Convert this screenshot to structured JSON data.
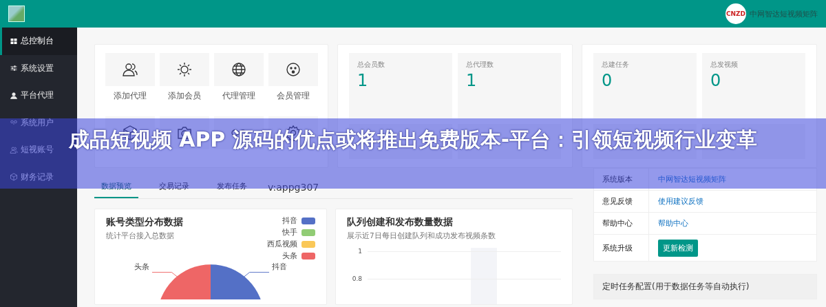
{
  "topbar": {
    "brand_badge": "CNZD",
    "brand_name": "中网智达短视频矩阵"
  },
  "sidebar": {
    "items": [
      {
        "label": "总控制台",
        "selected": true
      },
      {
        "label": "系统设置",
        "selected": false
      },
      {
        "label": "平台代理",
        "selected": false
      },
      {
        "label": "系统用户",
        "selected": false
      },
      {
        "label": "短视账号",
        "selected": false
      },
      {
        "label": "财务记录",
        "selected": false
      }
    ]
  },
  "shortcuts": [
    {
      "label": "添加代理"
    },
    {
      "label": "添加会员"
    },
    {
      "label": "代理管理"
    },
    {
      "label": "会员管理"
    }
  ],
  "stat_groups": [
    [
      {
        "label": "总会员数",
        "value": "1"
      },
      {
        "label": "总代理数",
        "value": "1"
      }
    ],
    [
      {
        "label": "总建任务",
        "value": "0"
      },
      {
        "label": "总发视频",
        "value": "0"
      }
    ]
  ],
  "tabs": [
    {
      "label": "数据预览",
      "selected": true
    },
    {
      "label": "交易记录",
      "selected": false
    },
    {
      "label": "发布任务",
      "selected": false
    }
  ],
  "tabs_note": "v:appg307",
  "pie_card": {
    "title": "账号类型分布数据",
    "subtitle": "统计平台接入总数据",
    "legend": [
      {
        "label": "抖音",
        "color": "#5470c6"
      },
      {
        "label": "快手",
        "color": "#91cc75"
      },
      {
        "label": "西瓜视频",
        "color": "#fac858"
      },
      {
        "label": "头条",
        "color": "#ee6666"
      }
    ],
    "slice_labels": [
      "头条",
      "抖音"
    ]
  },
  "bar_card": {
    "title": "队列创建和发布数量数据",
    "subtitle": "展示近7日每日创建队列和成功发布视频条数",
    "axis_labels": [
      "1",
      "0.8"
    ]
  },
  "info_table": [
    {
      "key": "系统版本",
      "value": "中网智达短视频矩阵",
      "kind": "link"
    },
    {
      "key": "意见反馈",
      "value": "使用建议反馈",
      "kind": "link"
    },
    {
      "key": "帮助中心",
      "value": "帮助中心",
      "kind": "link"
    },
    {
      "key": "系统升级",
      "value": "更新检测",
      "kind": "button"
    }
  ],
  "cron_panel": {
    "title": "定时任务配置(用于数据任务等自动执行)"
  },
  "banner": {
    "title": "成品短视频 APP 源码的优点或将推出免费版本-平台：引领短视频行业变革"
  }
}
